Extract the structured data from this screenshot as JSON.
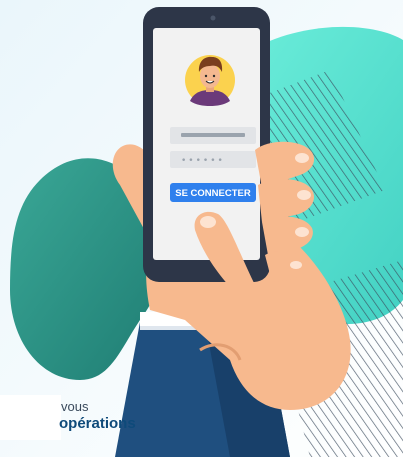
{
  "login": {
    "button_label": "SE CONNECTER",
    "password_mask": "••••••"
  },
  "caption": {
    "line1": "vous",
    "line2": "opérations"
  },
  "colors": {
    "teal_light": "#5ee6d6",
    "teal_dark": "#2f9e8c",
    "phone_body": "#2d3648",
    "screen": "#f2f2f2",
    "button": "#2f80ed",
    "skin": "#f7b98e",
    "sleeve": "#1f4f7f",
    "cuff": "#ffffff",
    "caption_bold": "#0e4a7a"
  },
  "icons": {
    "avatar": "user-avatar-icon",
    "camera": "camera-dot-icon"
  }
}
